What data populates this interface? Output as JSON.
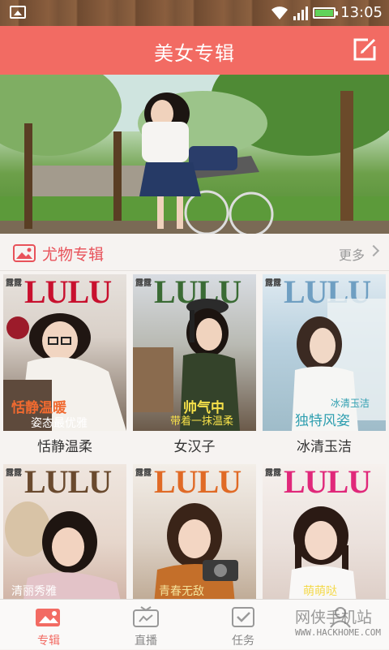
{
  "status": {
    "time": "13:05"
  },
  "header": {
    "title": "美女专辑"
  },
  "section": {
    "title": "尤物专辑",
    "more_label": "更多"
  },
  "albums": [
    {
      "caption": "恬静温柔",
      "masthead": "LULU",
      "masthead_color": "#c8102e",
      "cover_text_1": "恬静温暖",
      "cover_text_2": "姿态最优雅"
    },
    {
      "caption": "女汉子",
      "masthead": "LULU",
      "masthead_color": "#3a6b34",
      "cover_text_1": "帅气中",
      "cover_text_2": "带着一抹温柔"
    },
    {
      "caption": "冰清玉洁",
      "masthead": "LULU",
      "masthead_color": "#6f9fc2",
      "cover_text_1": "独特风姿",
      "cover_text_2": "冰清玉洁"
    },
    {
      "caption": "",
      "masthead": "LULU",
      "masthead_color": "#6a4a2e",
      "cover_text_1": "清丽秀雅",
      "cover_text_2": ""
    },
    {
      "caption": "",
      "masthead": "LULU",
      "masthead_color": "#e06a26",
      "cover_text_1": "青春无敌",
      "cover_text_2": ""
    },
    {
      "caption": "",
      "masthead": "LULU",
      "masthead_color": "#e0287a",
      "cover_text_1": "萌萌哒",
      "cover_text_2": ""
    }
  ],
  "cover_tag": "露露",
  "tabs": [
    {
      "label": "专辑",
      "icon": "album-icon",
      "active": true
    },
    {
      "label": "直播",
      "icon": "live-tv-icon",
      "active": false
    },
    {
      "label": "任务",
      "icon": "task-icon",
      "active": false
    },
    {
      "label": "",
      "icon": "profile-icon",
      "active": false
    }
  ],
  "watermark": {
    "text": "网侠手机站",
    "url": "WWW.HACKHOME.COM"
  },
  "colors": {
    "accent": "#f26b63",
    "section_accent": "#e8525a"
  }
}
